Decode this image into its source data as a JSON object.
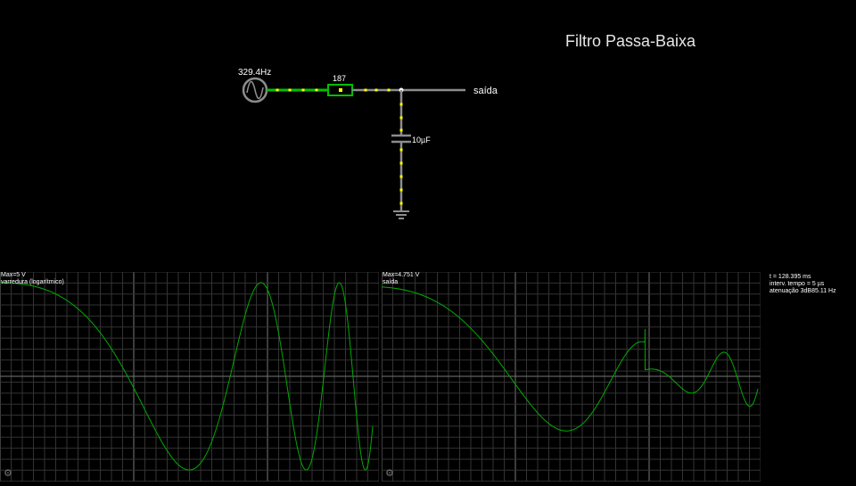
{
  "title": "Filtro Passa-Baixa",
  "circuit": {
    "source_frequency": "329.4Hz",
    "resistor_value": "187",
    "capacitor_value": "10µF",
    "output_label": "saída",
    "icons": {
      "source": "ac-source-icon",
      "resistor": "resistor-icon",
      "capacitor": "capacitor-icon",
      "ground": "ground-icon"
    }
  },
  "scope1": {
    "max_label": "Max=5 V",
    "name_label": "varredura (logarítmico)"
  },
  "scope2": {
    "max_label": "Max=4.751 V",
    "name_label": "saída"
  },
  "info": {
    "time": "t = 128.395 ms",
    "timestep": "interv. tempo = 5 µs",
    "attenuation": "atenuação 3dB85.11 Hz"
  },
  "colors": {
    "background": "#000000",
    "wire_active": "#00c000",
    "wire_idle": "#8c8c8c",
    "current_dot": "#ffff00",
    "trace": "#00aa00",
    "grid": "#444444"
  }
}
